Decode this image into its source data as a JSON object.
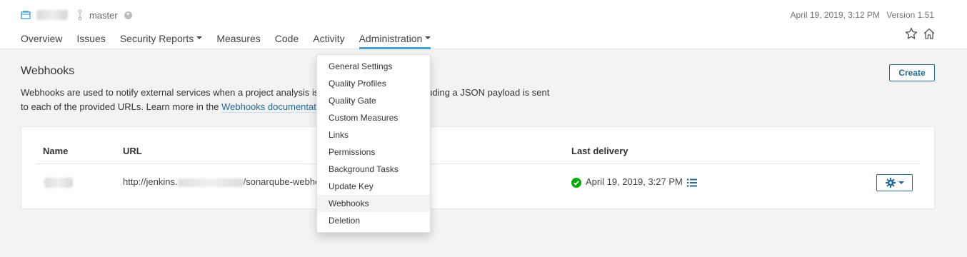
{
  "header": {
    "branch": "master",
    "branch_add_icon": "plus-circle-icon",
    "date": "April 19, 2019, 3:12 PM",
    "version": "Version 1.51"
  },
  "nav": {
    "overview": "Overview",
    "issues": "Issues",
    "security_reports": "Security Reports",
    "measures": "Measures",
    "code": "Code",
    "activity": "Activity",
    "administration": "Administration"
  },
  "page": {
    "title": "Webhooks",
    "create": "Create",
    "desc_line1": "Webhooks are used to notify external services when a project analysis is",
    "desc_line1_tail": "uest including a JSON payload is sent",
    "desc_line2": "to each of the provided URLs. Learn more in the",
    "desc_link": "Webhooks documentat"
  },
  "table": {
    "headers": {
      "name": "Name",
      "url": "URL",
      "last_delivery": "Last delivery"
    },
    "row": {
      "url_prefix": "http://jenkins.",
      "url_suffix": "/sonarqube-webho",
      "last_delivery": "April 19, 2019, 3:27 PM"
    }
  },
  "admin_menu": [
    "General Settings",
    "Quality Profiles",
    "Quality Gate",
    "Custom Measures",
    "Links",
    "Permissions",
    "Background Tasks",
    "Update Key",
    "Webhooks",
    "Deletion"
  ],
  "colors": {
    "accent": "#4b9fd5",
    "primary": "#236a97",
    "success": "#00aa00"
  }
}
